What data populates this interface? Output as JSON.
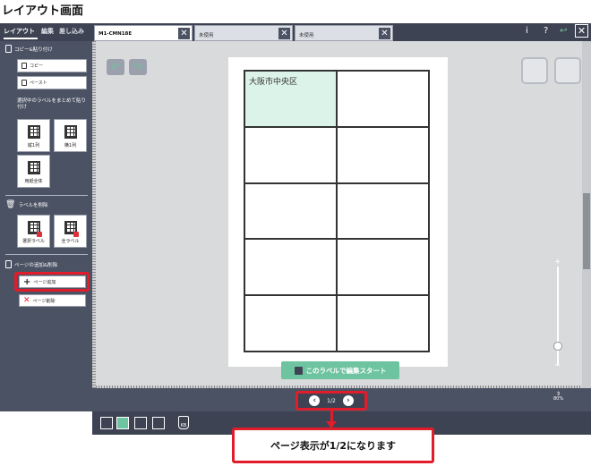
{
  "heading": "レイアウト画面",
  "left_tabs": [
    "レイアウト",
    "編集",
    "差し込み"
  ],
  "sections": {
    "copy_paste": {
      "title": "コピー&貼り付け",
      "copy": "コピー",
      "paste": "ペースト",
      "batch_title": "選択中のラベルをまとめて貼り付け",
      "col": "縦1列",
      "row": "横1列",
      "whole": "用紙全体"
    },
    "delete": {
      "title": "ラベルを削除",
      "selected": "選択ラベル",
      "all": "全ラベル"
    },
    "pages": {
      "title": "ページの追加&削除",
      "add": "ページ追加",
      "remove": "ページ削除"
    }
  },
  "doc_tabs": [
    "M1-CMN18E",
    "未使用",
    "未使用"
  ],
  "top_icons": [
    "i",
    "?",
    "↩",
    "✕"
  ],
  "grid_first_cell": "大阪市中央区",
  "start_button": "このラベルで編集スタート",
  "page_indicator": "1/2",
  "zoom": "80%",
  "callout": "ページ表示が1/2になります",
  "colors": {
    "accent": "#6ec3a0",
    "highlight": "#e11d2c",
    "panel": "#4b5263"
  }
}
